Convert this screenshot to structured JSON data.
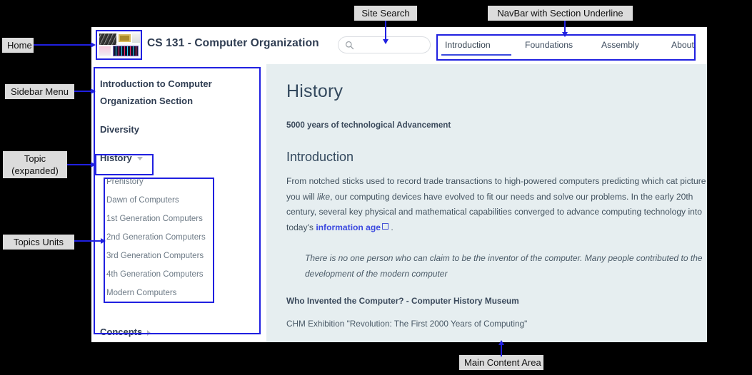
{
  "site": {
    "title": "CS 131 - Computer Organization",
    "logo_icon": "course-collage-thumbnail"
  },
  "search": {
    "placeholder": "",
    "value": "",
    "icon": "search-icon"
  },
  "navbar": {
    "items": [
      {
        "label": "Introduction",
        "active": true
      },
      {
        "label": "Foundations",
        "active": false
      },
      {
        "label": "Assembly",
        "active": false
      },
      {
        "label": "About",
        "active": false
      }
    ],
    "active_underline_color": "#3b49df"
  },
  "sidebar": {
    "items": [
      {
        "label": "Introduction to Computer Organization Section",
        "state": "none"
      },
      {
        "label": "Diversity",
        "state": "none"
      },
      {
        "label": "History",
        "state": "expanded",
        "caret": "caret-down-icon"
      },
      {
        "label": "Concepts",
        "state": "collapsed",
        "caret": "caret-right-icon"
      }
    ],
    "units": [
      "Prehistory",
      "Dawn of Computers",
      "1st Generation Computers",
      "2nd Generation Computers",
      "3rd Generation Computers",
      "4th Generation Computers",
      "Modern Computers"
    ]
  },
  "main": {
    "title": "History",
    "subtitle": "5000 years of technological Advancement",
    "section_title": "Introduction",
    "paragraph": {
      "part1": "From notched sticks used to record trade transactions to high-powered computers predicting which cat picture you will ",
      "emphasis": "like",
      "part2": ", our computing devices have evolved to fit our needs and solve our problems. In the early 20th century, several key physical and mathematical capabilities converged to advance computing technology into today's ",
      "link": "information age",
      "link_icon": "external-link-icon",
      "part3": " ."
    },
    "quote": "There is no one person who can claim to be the inventor of the computer. Many people contributed to the development of the modern computer",
    "caption_bold": "Who Invented the Computer? - Computer History Museum",
    "caption_plain": "CHM Exhibition \"Revolution: The First 2000 Years of Computing\""
  },
  "annotations": [
    {
      "id": "home",
      "label": "Home"
    },
    {
      "id": "site-search",
      "label": "Site Search"
    },
    {
      "id": "navbar-underline",
      "label": "NavBar with Section Underline"
    },
    {
      "id": "sidebar-menu",
      "label": "Sidebar Menu"
    },
    {
      "id": "topic-expanded",
      "label": "Topic\n(expanded)"
    },
    {
      "id": "topics-units",
      "label": "Topics Units"
    },
    {
      "id": "main-content",
      "label": "Main Content Area"
    }
  ],
  "colors": {
    "annotation": "#2020e0",
    "annotation_label_bg": "#dcdcdc",
    "main_bg": "#e6eef0",
    "accent": "#3b49df",
    "heading": "#34495e"
  }
}
